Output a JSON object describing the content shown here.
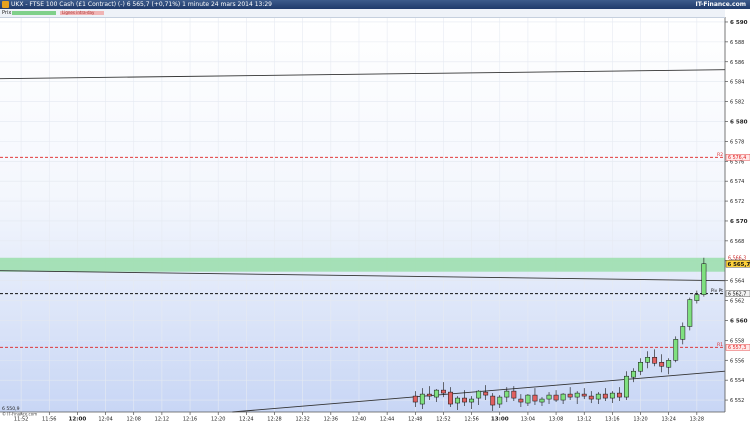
{
  "window": {
    "title": "UKX - FTSE 100 Cash (£1 Contract) (-)   6 565,7 (+0,71%)   1 minute  24 mars 2014 13:29",
    "brand": "IT-Finance.com"
  },
  "legend": {
    "price_label": "Prix",
    "pink_label": "Lignes intra-day"
  },
  "chart_data": {
    "type": "candlestick",
    "instrument": "UKX - FTSE 100 Cash (£1 Contract) (-)",
    "timeframe": "1 minute",
    "ylim": [
      6550.8,
      6590.5
    ],
    "y_ticks": [
      6552,
      6554,
      6556,
      6558,
      6560,
      6562,
      6564,
      6566,
      6568,
      6570,
      6572,
      6574,
      6576,
      6578,
      6580,
      6582,
      6584,
      6586,
      6588,
      6590
    ],
    "y_tick_labels": [
      "6 552",
      "6 554",
      "6 556",
      "6 558",
      "6 560",
      "6 562",
      "6 564",
      "6 566",
      "6 568",
      "6 570",
      "6 572",
      "6 574",
      "6 576",
      "6 578",
      "6 580",
      "6 582",
      "6 584",
      "6 586",
      "6 588",
      "6 590"
    ],
    "y_ticks_bold": [
      6560,
      6570,
      6580,
      6590
    ],
    "x_ticks": [
      {
        "label": "11:52",
        "m": 0
      },
      {
        "label": "11:56",
        "m": 4
      },
      {
        "label": "12:00",
        "m": 8,
        "bold": true
      },
      {
        "label": "12:04",
        "m": 12
      },
      {
        "label": "12:08",
        "m": 16
      },
      {
        "label": "12:12",
        "m": 20
      },
      {
        "label": "12:16",
        "m": 24
      },
      {
        "label": "12:20",
        "m": 28
      },
      {
        "label": "12:24",
        "m": 32
      },
      {
        "label": "12:28",
        "m": 36
      },
      {
        "label": "12:32",
        "m": 40
      },
      {
        "label": "12:36",
        "m": 44
      },
      {
        "label": "12:40",
        "m": 48
      },
      {
        "label": "12:44",
        "m": 52
      },
      {
        "label": "12:48",
        "m": 56
      },
      {
        "label": "12:52",
        "m": 60
      },
      {
        "label": "12:56",
        "m": 64
      },
      {
        "label": "13:00",
        "m": 68,
        "bold": true
      },
      {
        "label": "13:04",
        "m": 72
      },
      {
        "label": "13:08",
        "m": 76
      },
      {
        "label": "13:12",
        "m": 80
      },
      {
        "label": "13:16",
        "m": 84
      },
      {
        "label": "13:20",
        "m": 88
      },
      {
        "label": "13:24",
        "m": 92
      },
      {
        "label": "13:28",
        "m": 96
      }
    ],
    "x_range_minutes": [
      -3,
      100
    ],
    "bottom_left_label": "6 550,9",
    "bottom_left_sub": "© IT-Finance.com",
    "last_price": 6565.7,
    "last_price_label": "6 565,7",
    "green_zone": [
      6564.9,
      6566.3
    ],
    "green_zone_top_label": "6 566,3",
    "horizontal_levels": [
      {
        "name": "R2",
        "value": 6576.4,
        "label": "6 576,4",
        "style": "red-dashed"
      },
      {
        "name": "Pivot",
        "value": 6562.7,
        "label": "6 562,7",
        "style": "black-dashed",
        "tag": "Piv Pt"
      },
      {
        "name": "R1",
        "value": 6557.3,
        "label": "6 557,3",
        "style": "red-dashed"
      }
    ],
    "trendlines": [
      {
        "from": {
          "m": -3,
          "y": 6584.3
        },
        "to": {
          "m": 100,
          "y": 6585.2
        }
      },
      {
        "from": {
          "m": -3,
          "y": 6565.0
        },
        "to": {
          "m": 100,
          "y": 6564.0
        }
      },
      {
        "from": {
          "m": 30,
          "y": 6550.8
        },
        "to": {
          "m": 100,
          "y": 6554.9
        }
      }
    ],
    "candles": [
      {
        "m": 56,
        "o": 6552.4,
        "h": 6552.9,
        "l": 6551.3,
        "c": 6551.8
      },
      {
        "m": 57,
        "o": 6551.6,
        "h": 6553.2,
        "l": 6551.1,
        "c": 6552.6
      },
      {
        "m": 58,
        "o": 6552.6,
        "h": 6553.4,
        "l": 6552.0,
        "c": 6552.4
      },
      {
        "m": 59,
        "o": 6552.3,
        "h": 6553.1,
        "l": 6551.8,
        "c": 6553.0
      },
      {
        "m": 60,
        "o": 6553.0,
        "h": 6553.8,
        "l": 6552.3,
        "c": 6552.7
      },
      {
        "m": 61,
        "o": 6552.8,
        "h": 6553.3,
        "l": 6551.3,
        "c": 6551.6
      },
      {
        "m": 62,
        "o": 6551.7,
        "h": 6552.4,
        "l": 6551.0,
        "c": 6552.2
      },
      {
        "m": 63,
        "o": 6552.2,
        "h": 6553.0,
        "l": 6551.4,
        "c": 6551.8
      },
      {
        "m": 64,
        "o": 6551.8,
        "h": 6552.4,
        "l": 6551.1,
        "c": 6552.1
      },
      {
        "m": 65,
        "o": 6552.2,
        "h": 6553.0,
        "l": 6551.5,
        "c": 6552.9
      },
      {
        "m": 66,
        "o": 6552.8,
        "h": 6553.5,
        "l": 6552.0,
        "c": 6552.5
      },
      {
        "m": 67,
        "o": 6552.4,
        "h": 6552.7,
        "l": 6550.9,
        "c": 6551.5
      },
      {
        "m": 68,
        "o": 6551.6,
        "h": 6552.5,
        "l": 6551.2,
        "c": 6552.3
      },
      {
        "m": 69,
        "o": 6552.3,
        "h": 6553.3,
        "l": 6551.8,
        "c": 6552.9
      },
      {
        "m": 70,
        "o": 6552.9,
        "h": 6553.4,
        "l": 6551.9,
        "c": 6552.2
      },
      {
        "m": 71,
        "o": 6552.1,
        "h": 6552.6,
        "l": 6551.3,
        "c": 6551.8
      },
      {
        "m": 72,
        "o": 6551.7,
        "h": 6552.6,
        "l": 6551.4,
        "c": 6552.5
      },
      {
        "m": 73,
        "o": 6552.5,
        "h": 6553.2,
        "l": 6551.5,
        "c": 6551.9
      },
      {
        "m": 74,
        "o": 6551.8,
        "h": 6552.3,
        "l": 6551.4,
        "c": 6552.1
      },
      {
        "m": 75,
        "o": 6552.1,
        "h": 6552.8,
        "l": 6551.6,
        "c": 6552.5
      },
      {
        "m": 76,
        "o": 6552.5,
        "h": 6553.0,
        "l": 6551.8,
        "c": 6552.0
      },
      {
        "m": 77,
        "o": 6552.0,
        "h": 6552.7,
        "l": 6551.6,
        "c": 6552.6
      },
      {
        "m": 78,
        "o": 6552.6,
        "h": 6553.3,
        "l": 6552.0,
        "c": 6552.3
      },
      {
        "m": 79,
        "o": 6552.3,
        "h": 6552.9,
        "l": 6551.6,
        "c": 6552.7
      },
      {
        "m": 80,
        "o": 6552.6,
        "h": 6553.2,
        "l": 6552.1,
        "c": 6552.4
      },
      {
        "m": 81,
        "o": 6552.4,
        "h": 6552.9,
        "l": 6551.7,
        "c": 6552.1
      },
      {
        "m": 82,
        "o": 6552.1,
        "h": 6552.8,
        "l": 6551.6,
        "c": 6552.6
      },
      {
        "m": 83,
        "o": 6552.6,
        "h": 6553.2,
        "l": 6551.9,
        "c": 6552.2
      },
      {
        "m": 84,
        "o": 6552.2,
        "h": 6552.9,
        "l": 6551.7,
        "c": 6552.7
      },
      {
        "m": 85,
        "o": 6552.7,
        "h": 6553.3,
        "l": 6551.9,
        "c": 6552.3
      },
      {
        "m": 86,
        "o": 6552.3,
        "h": 6554.9,
        "l": 6552.0,
        "c": 6554.4
      },
      {
        "m": 87,
        "o": 6554.3,
        "h": 6555.2,
        "l": 6553.8,
        "c": 6554.9
      },
      {
        "m": 88,
        "o": 6554.9,
        "h": 6556.2,
        "l": 6554.5,
        "c": 6555.8
      },
      {
        "m": 89,
        "o": 6555.8,
        "h": 6556.9,
        "l": 6555.2,
        "c": 6556.3
      },
      {
        "m": 90,
        "o": 6556.3,
        "h": 6557.1,
        "l": 6555.4,
        "c": 6555.7
      },
      {
        "m": 91,
        "o": 6555.8,
        "h": 6556.6,
        "l": 6554.8,
        "c": 6555.4
      },
      {
        "m": 92,
        "o": 6555.3,
        "h": 6556.2,
        "l": 6554.6,
        "c": 6556.0
      },
      {
        "m": 93,
        "o": 6556.0,
        "h": 6558.4,
        "l": 6555.8,
        "c": 6558.1
      },
      {
        "m": 94,
        "o": 6558.1,
        "h": 6559.8,
        "l": 6557.6,
        "c": 6559.4
      },
      {
        "m": 95,
        "o": 6559.4,
        "h": 6562.3,
        "l": 6559.0,
        "c": 6562.1
      },
      {
        "m": 96,
        "o": 6562.0,
        "h": 6563.0,
        "l": 6561.7,
        "c": 6562.6
      },
      {
        "m": 97,
        "o": 6562.6,
        "h": 6566.3,
        "l": 6562.4,
        "c": 6565.7
      }
    ],
    "colors": {
      "up_fill": "#7fe07f",
      "down_fill": "#e06060",
      "candle_outline": "#111111",
      "level_red": "#e02020",
      "green_zone": "#8fdca0",
      "last_price_bg": "#ffd23a",
      "background_top": "#ffffff",
      "background_bottom": "#c8d6f5"
    }
  }
}
